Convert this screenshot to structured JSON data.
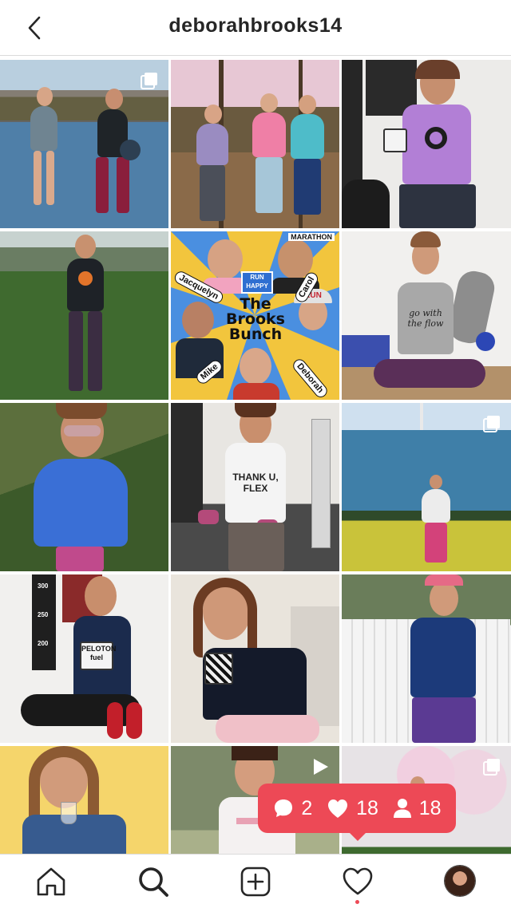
{
  "header": {
    "title": "deborahbrooks14"
  },
  "posts": [
    {
      "type": "multi"
    },
    {
      "type": "photo"
    },
    {
      "type": "photo",
      "mug_label": ""
    },
    {
      "type": "photo"
    },
    {
      "type": "photo",
      "graphic": {
        "title": "The Brooks Bunch",
        "names": [
          "Jacquelyn",
          "Carol",
          "Mike",
          "Deborah"
        ],
        "marathon": "MARATHON",
        "run_happy": "RUN HAPPY",
        "cap_text": "RUN"
      }
    },
    {
      "type": "photo",
      "shirt_text": "go with the flow"
    },
    {
      "type": "photo"
    },
    {
      "type": "photo",
      "shirt_text": "THANK U, FLEX"
    },
    {
      "type": "multi"
    },
    {
      "type": "photo",
      "mug_text": "PELOTON fuel",
      "signs": [
        "300",
        "250",
        "200"
      ]
    },
    {
      "type": "photo"
    },
    {
      "type": "photo"
    },
    {
      "type": "photo"
    },
    {
      "type": "video"
    },
    {
      "type": "multi"
    }
  ],
  "activity_badge": {
    "comments": "2",
    "likes": "18",
    "follows": "18",
    "color": "#ed4956"
  },
  "nav": [
    "home",
    "search",
    "new-post",
    "activity",
    "profile"
  ]
}
